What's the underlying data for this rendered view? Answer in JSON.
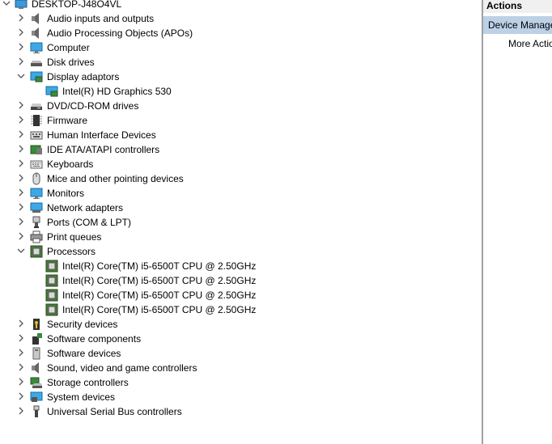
{
  "tree": {
    "root": "DESKTOP-J48O4VL",
    "categories": [
      {
        "label": "Audio inputs and outputs",
        "icon": "speaker-icon"
      },
      {
        "label": "Audio Processing Objects (APOs)",
        "icon": "speaker-icon"
      },
      {
        "label": "Computer",
        "icon": "monitor-icon"
      },
      {
        "label": "Disk drives",
        "icon": "disk-drive-icon"
      },
      {
        "label": "Display adaptors",
        "icon": "display-adapter-icon"
      },
      {
        "label": "Intel(R) HD Graphics 530",
        "icon": "display-adapter-icon"
      },
      {
        "label": "DVD/CD-ROM drives",
        "icon": "dvd-drive-icon"
      },
      {
        "label": "Firmware",
        "icon": "firmware-icon"
      },
      {
        "label": "Human Interface Devices",
        "icon": "hid-icon"
      },
      {
        "label": "IDE ATA/ATAPI controllers",
        "icon": "ide-controller-icon"
      },
      {
        "label": "Keyboards",
        "icon": "keyboard-icon"
      },
      {
        "label": "Mice and other pointing devices",
        "icon": "mouse-icon"
      },
      {
        "label": "Monitors",
        "icon": "monitor-icon"
      },
      {
        "label": "Network adapters",
        "icon": "network-icon"
      },
      {
        "label": "Ports (COM & LPT)",
        "icon": "port-icon"
      },
      {
        "label": "Print queues",
        "icon": "printer-icon"
      },
      {
        "label": "Processors",
        "icon": "processor-icon"
      },
      {
        "label": "Intel(R) Core(TM) i5-6500T CPU @ 2.50GHz",
        "icon": "processor-icon"
      },
      {
        "label": "Intel(R) Core(TM) i5-6500T CPU @ 2.50GHz",
        "icon": "processor-icon"
      },
      {
        "label": "Intel(R) Core(TM) i5-6500T CPU @ 2.50GHz",
        "icon": "processor-icon"
      },
      {
        "label": "Intel(R) Core(TM) i5-6500T CPU @ 2.50GHz",
        "icon": "processor-icon"
      },
      {
        "label": "Security devices",
        "icon": "security-icon"
      },
      {
        "label": "Software components",
        "icon": "software-component-icon"
      },
      {
        "label": "Software devices",
        "icon": "software-device-icon"
      },
      {
        "label": "Sound, video and game controllers",
        "icon": "speaker-icon"
      },
      {
        "label": "Storage controllers",
        "icon": "storage-controller-icon"
      },
      {
        "label": "System devices",
        "icon": "system-device-icon"
      },
      {
        "label": "Universal Serial Bus controllers",
        "icon": "usb-icon"
      }
    ]
  },
  "actions": {
    "title": "Actions",
    "section": "Device Manager",
    "more": "More Actions"
  },
  "colors": {
    "selected_section": "#bcd0e6",
    "header_bg": "#f0f0f0",
    "separator": "#a0a0a0"
  }
}
